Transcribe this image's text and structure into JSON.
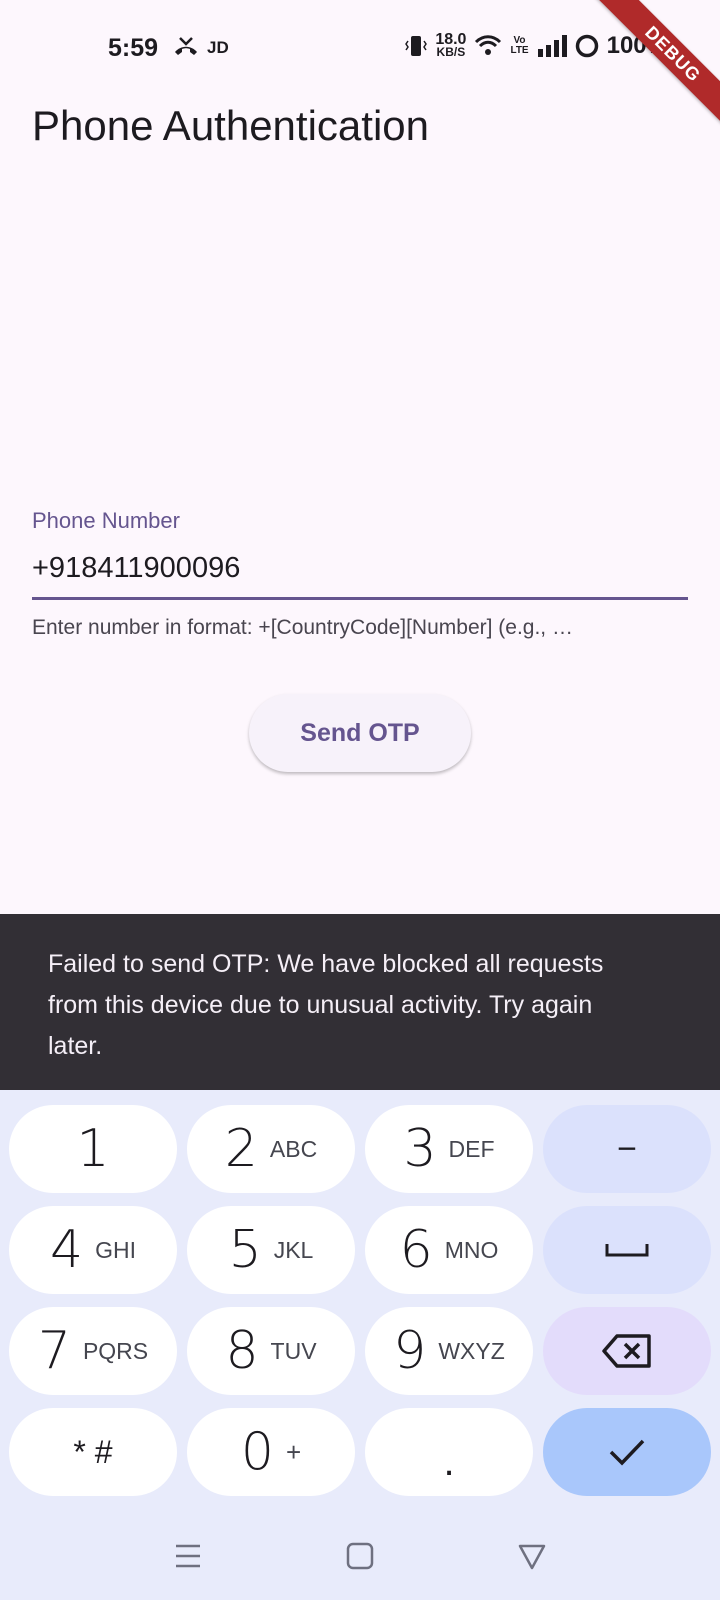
{
  "status_bar": {
    "time": "5:59",
    "carrier": "JD",
    "speed_value": "18.0",
    "speed_unit": "KB/S",
    "volte_top": "Vo",
    "volte_bottom": "LTE",
    "battery": "100%"
  },
  "debug_banner": "DEBUG",
  "app_bar": {
    "title": "Phone Authentication"
  },
  "phone_field": {
    "label": "Phone Number",
    "value": "+918411900096",
    "helper": "Enter number in format: +[CountryCode][Number] (e.g., …"
  },
  "send_button": {
    "label": "Send OTP"
  },
  "snackbar": {
    "message": "Failed to send OTP: We have blocked all requests from this device due to unusual activity. Try again later."
  },
  "keypad": {
    "keys": [
      {
        "main": "1",
        "sub": ""
      },
      {
        "main": "2",
        "sub": "ABC"
      },
      {
        "main": "3",
        "sub": "DEF"
      },
      {
        "main": "4",
        "sub": "GHI"
      },
      {
        "main": "5",
        "sub": "JKL"
      },
      {
        "main": "6",
        "sub": "MNO"
      },
      {
        "main": "7",
        "sub": "PQRS"
      },
      {
        "main": "8",
        "sub": "TUV"
      },
      {
        "main": "9",
        "sub": "WXYZ"
      },
      {
        "main": "* #",
        "sub": ""
      },
      {
        "main": "0",
        "sub": "+"
      },
      {
        "main": ".",
        "sub": ""
      }
    ],
    "minus": "−"
  },
  "colors": {
    "background": "#fdf7fd",
    "accent": "#65558f",
    "snackbar": "#322f35",
    "keyboard": "#e8ebfb",
    "done_key": "#a9c7fb",
    "debug_ribbon": "#b02a2a"
  }
}
